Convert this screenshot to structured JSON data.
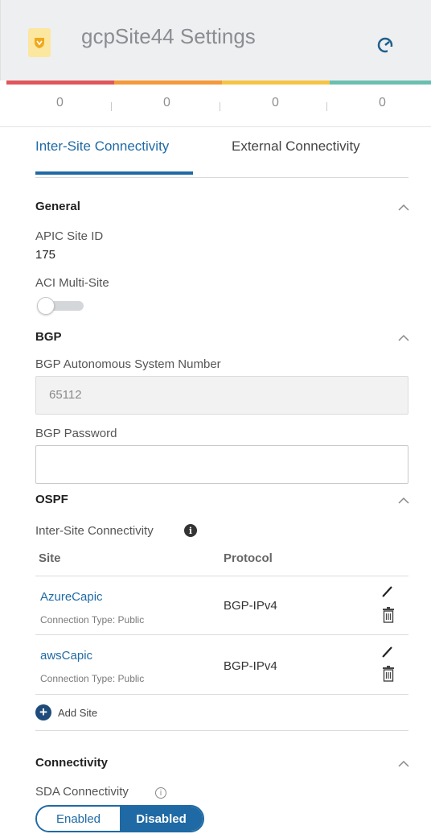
{
  "header": {
    "title": "gcpSite44 Settings",
    "logo_icon": "shield-icon",
    "action_icon": "health-refresh-icon"
  },
  "status_colors": [
    "#e0565b",
    "#f49a3b",
    "#f5c445",
    "#6bbfb0"
  ],
  "counts": [
    "0",
    "0",
    "0",
    "0"
  ],
  "tabs": [
    {
      "label": "Inter-Site Connectivity",
      "active": true
    },
    {
      "label": "External Connectivity",
      "active": false
    }
  ],
  "general": {
    "title": "General",
    "apic_site_id_label": "APIC Site ID",
    "apic_site_id_value": "175",
    "aci_multisite_label": "ACI Multi-Site",
    "aci_multisite_enabled": false
  },
  "bgp": {
    "title": "BGP",
    "asn_label": "BGP Autonomous System Number",
    "asn_value": "65112",
    "password_label": "BGP Password",
    "password_value": ""
  },
  "ospf": {
    "title": "OSPF",
    "inter_site_label": "Inter-Site Connectivity",
    "table_headers": {
      "site": "Site",
      "protocol": "Protocol"
    },
    "rows": [
      {
        "site": "AzureCapic",
        "connection_type": "Connection Type: Public",
        "protocol": "BGP-IPv4"
      },
      {
        "site": "awsCapic",
        "connection_type": "Connection Type: Public",
        "protocol": "BGP-IPv4"
      }
    ],
    "add_site_label": "Add Site"
  },
  "connectivity": {
    "title": "Connectivity",
    "sda_label": "SDA Connectivity",
    "options": [
      "Enabled",
      "Disabled"
    ],
    "selected": "Disabled"
  }
}
